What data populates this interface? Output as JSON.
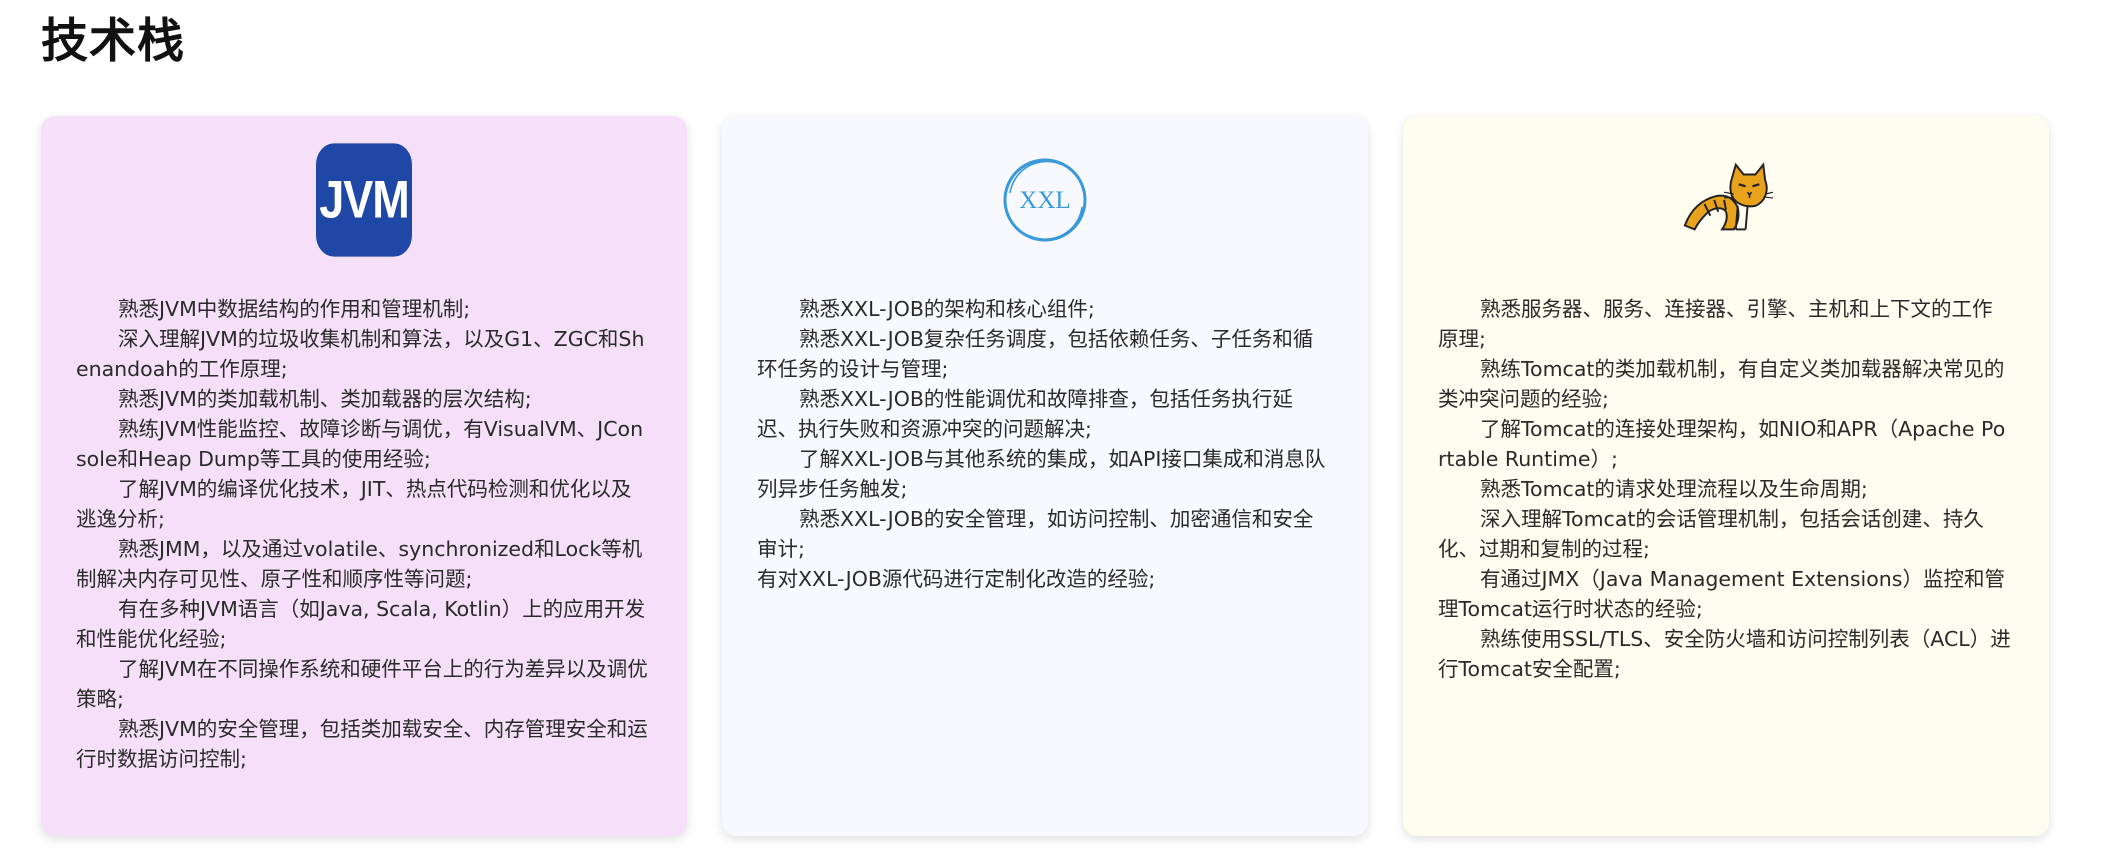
{
  "page": {
    "title": "技术栈"
  },
  "colors": {
    "card_jvm_bg": "#f5dff9",
    "card_xxl_bg": "#f8f9fe",
    "card_tomcat_bg": "#fefdf0",
    "jvm_logo_bg": "#1f47a6",
    "xxl_logo_color": "#3a9ad9",
    "tomcat_logo_color": "#e8a21c"
  },
  "cards": [
    {
      "logo": {
        "text": "JVM",
        "icon": "jvm-logo-icon"
      },
      "items": [
        "熟悉JVM中数据结构的作用和管理机制;",
        "深入理解JVM的垃圾收集机制和算法，以及G1、ZGC和Shenandoah的工作原理;",
        "熟悉JVM的类加载机制、类加载器的层次结构;",
        "熟练JVM性能监控、故障诊断与调优，有VisualVM、JConsole和Heap Dump等工具的使用经验;",
        "了解JVM的编译优化技术，JIT、热点代码检测和优化以及逃逸分析;",
        "熟悉JMM，以及通过volatile、synchronized和Lock等机制解决内存可见性、原子性和顺序性等问题;",
        "有在多种JVM语言（如Java, Scala, Kotlin）上的应用开发和性能优化经验;",
        "了解JVM在不同操作系统和硬件平台上的行为差异以及调优策略;",
        "熟悉JVM的安全管理，包括类加载安全、内存管理安全和运行时数据访问控制;"
      ]
    },
    {
      "logo": {
        "text": "XXL",
        "icon": "xxl-job-logo-icon"
      },
      "items": [
        "熟悉XXL-JOB的架构和核心组件;",
        "熟悉XXL-JOB复杂任务调度，包括依赖任务、子任务和循环任务的设计与管理;",
        "熟悉XXL-JOB的性能调优和故障排查，包括任务执行延迟、执行失败和资源冲突的问题解决;",
        "了解XXL-JOB与其他系统的集成，如API接口集成和消息队列异步任务触发;",
        "熟悉XXL-JOB的安全管理，如访问控制、加密通信和安全审计;",
        "有对XXL-JOB源代码进行定制化改造的经验;"
      ]
    },
    {
      "logo": {
        "icon": "tomcat-logo-icon"
      },
      "items": [
        "熟悉服务器、服务、连接器、引擎、主机和上下文的工作原理;",
        "熟练Tomcat的类加载机制，有自定义类加载器解决常见的类冲突问题的经验;",
        "了解Tomcat的连接处理架构，如NIO和APR（Apache Portable Runtime）;",
        "熟悉Tomcat的请求处理流程以及生命周期;",
        "深入理解Tomcat的会话管理机制，包括会话创建、持久化、过期和复制的过程;",
        "有通过JMX（Java Management Extensions）监控和管理Tomcat运行时状态的经验;",
        "熟练使用SSL/TLS、安全防火墙和访问控制列表（ACL）进行Tomcat安全配置;"
      ]
    }
  ]
}
